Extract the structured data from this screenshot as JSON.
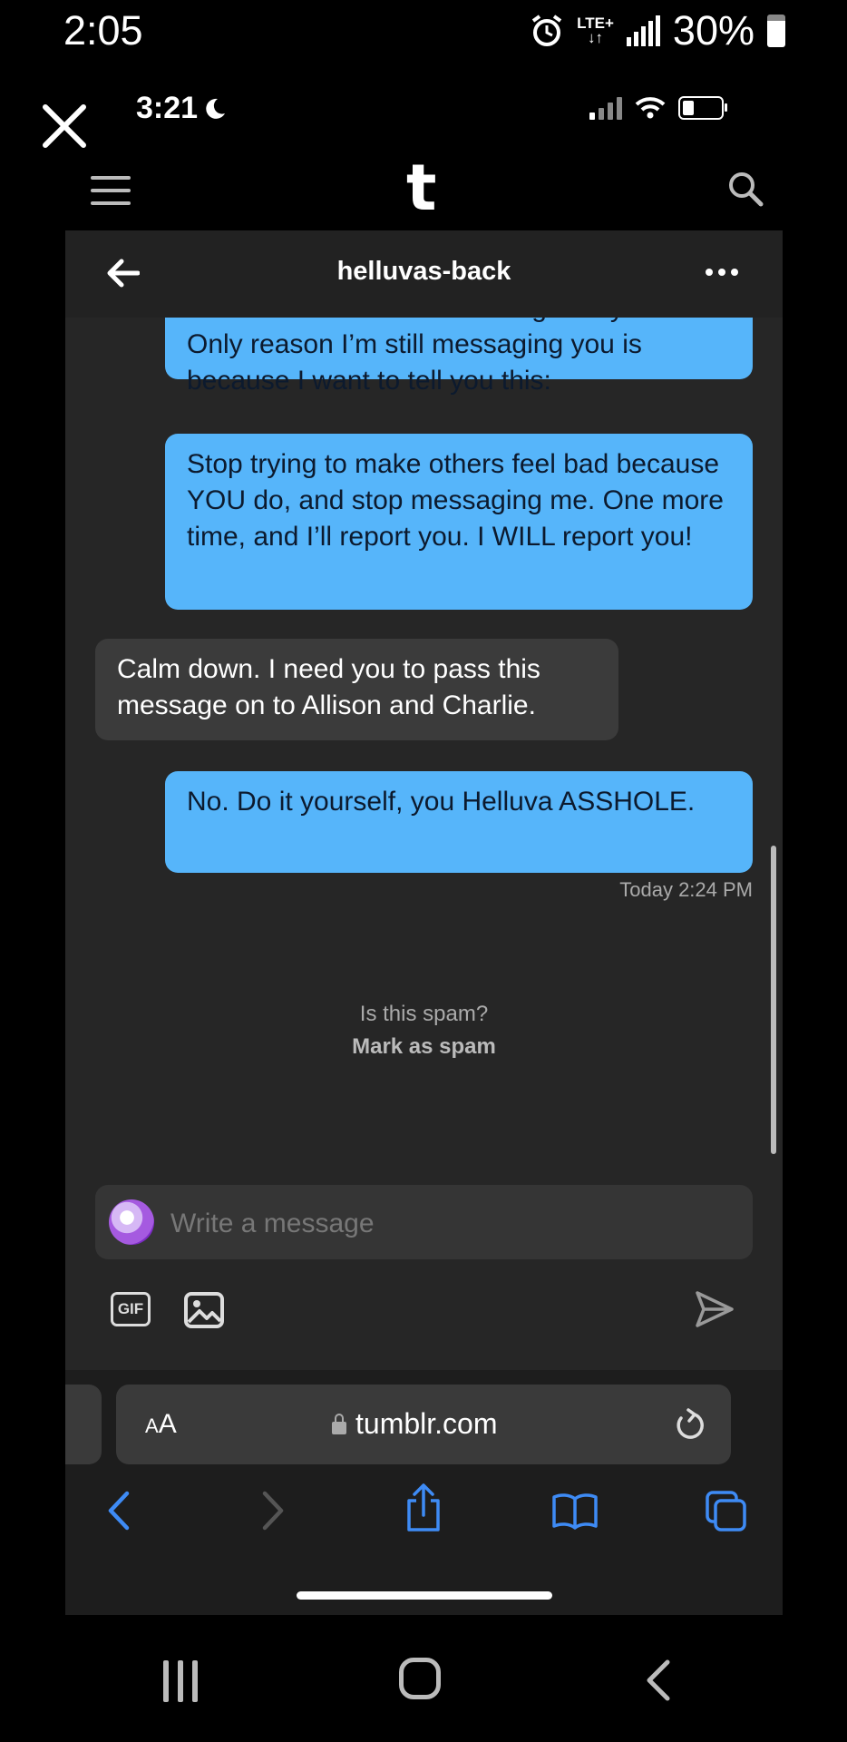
{
  "os_status": {
    "time": "2:05",
    "network": "LTE+",
    "battery": "30%"
  },
  "ios_status": {
    "time": "3:21"
  },
  "app": {
    "logo": "t"
  },
  "conversation": {
    "title": "helluvas-back",
    "messages": [
      {
        "from": "me",
        "text": "damn well that I’m not dealing with your shit. Only reason I’m still messaging you is because I want to tell you this:"
      },
      {
        "from": "me",
        "text": "Stop trying to make others feel bad because YOU do, and stop messaging me. One more time, and I’ll report you. I WILL report you!"
      },
      {
        "from": "them",
        "text": "Calm down. I need you to pass this message on to Allison and Charlie."
      },
      {
        "from": "me",
        "text": "No. Do it yourself, you Helluva ASSHOLE."
      }
    ],
    "timestamp": "Today 2:24 PM",
    "spam_question": "Is this spam?",
    "spam_action": "Mark as spam"
  },
  "composer": {
    "placeholder": "Write a message",
    "gif_label": "GIF"
  },
  "browser": {
    "text_size_label_small": "A",
    "text_size_label_large": "A",
    "url": "tumblr.com"
  },
  "colors": {
    "outgoing_bubble": "#56b5fa",
    "incoming_bubble": "#3b3b3b",
    "panel": "#262626",
    "browser_accent": "#3e8bf5"
  }
}
